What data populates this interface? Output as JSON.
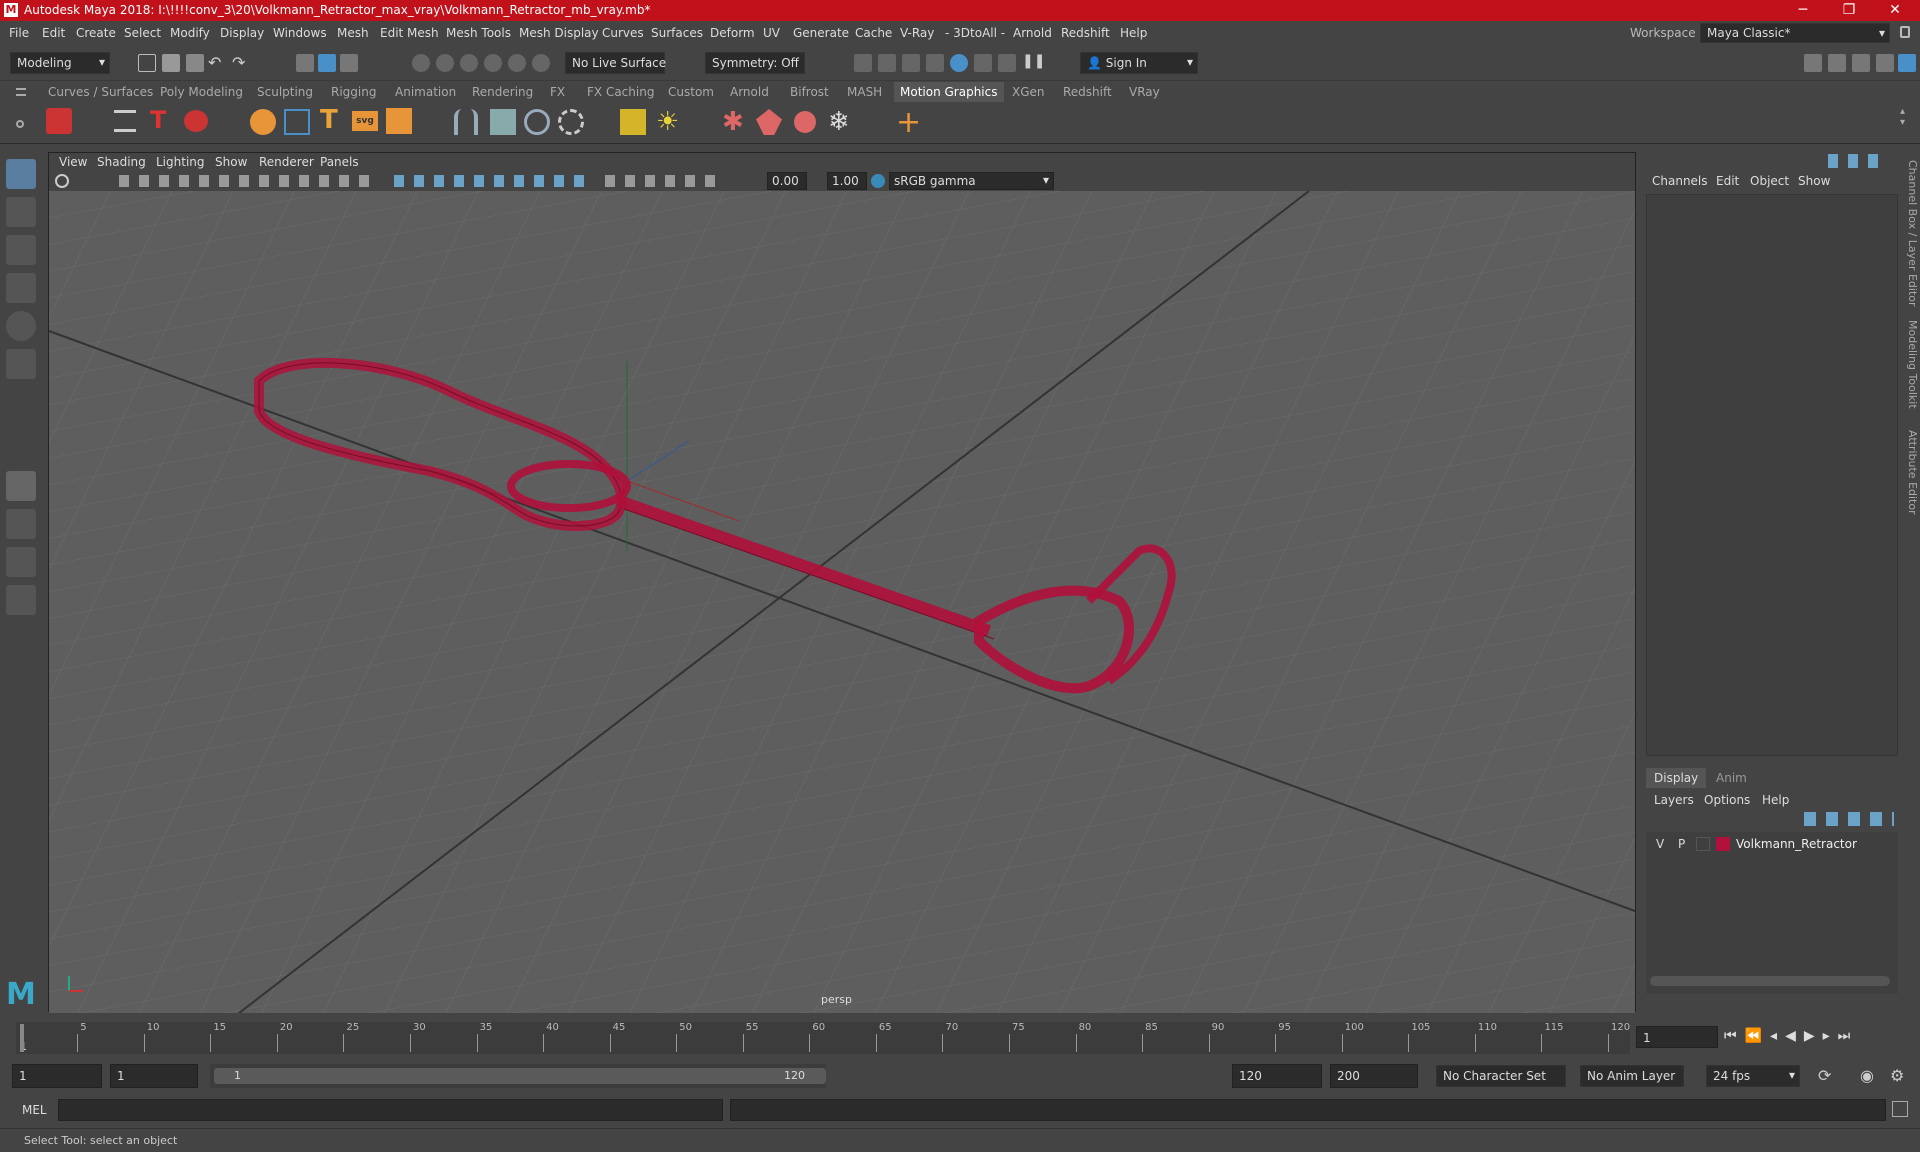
{
  "window": {
    "title": "Autodesk Maya 2018: I:\\!!!!conv_3\\20\\Volkmann_Retractor_max_vray\\Volkmann_Retractor_mb_vray.mb*",
    "logo": "M",
    "min": "─",
    "max": "❐",
    "close": "✕"
  },
  "menus": [
    "File",
    "Edit",
    "Create",
    "Select",
    "Modify",
    "Display",
    "Windows",
    "Mesh",
    "Edit Mesh",
    "Mesh Tools",
    "Mesh Display",
    "Curves",
    "Surfaces",
    "Deform",
    "UV",
    "Generate",
    "Cache",
    "V-Ray",
    "- 3DtoAll -",
    "Arnold",
    "Redshift",
    "Help"
  ],
  "workspace": {
    "label": "Workspace :",
    "value": "Maya Classic*"
  },
  "status": {
    "mode": "Modeling",
    "live_surface": "No Live Surface",
    "symmetry": "Symmetry: Off",
    "sign_in": "Sign In"
  },
  "shelf_tabs": [
    "Curves / Surfaces",
    "Poly Modeling",
    "Sculpting",
    "Rigging",
    "Animation",
    "Rendering",
    "FX",
    "FX Caching",
    "Custom",
    "Arnold",
    "Bifrost",
    "MASH",
    "Motion Graphics",
    "XGen",
    "Redshift",
    "VRay"
  ],
  "shelf_active": "Motion Graphics",
  "viewport": {
    "menus": [
      "View",
      "Shading",
      "Lighting",
      "Show",
      "Renderer",
      "Panels"
    ],
    "exposure": "0.00",
    "gamma": "1.00",
    "color_space": "sRGB gamma",
    "camera": "persp"
  },
  "channel_box": {
    "menus": [
      "Channels",
      "Edit",
      "Object",
      "Show"
    ]
  },
  "side_tabs": [
    "Channel Box / Layer Editor",
    "Modeling Toolkit",
    "Attribute Editor"
  ],
  "layer_editor": {
    "tabs": [
      "Display",
      "Anim"
    ],
    "menus": [
      "Layers",
      "Options",
      "Help"
    ],
    "layer": {
      "v": "V",
      "p": "P",
      "name": "Volkmann_Retractor",
      "color": "#b0103a"
    }
  },
  "timeline": {
    "ticks": [
      "5",
      "10",
      "15",
      "20",
      "25",
      "30",
      "35",
      "40",
      "45",
      "50",
      "55",
      "60",
      "65",
      "70",
      "75",
      "80",
      "85",
      "90",
      "95",
      "100",
      "105",
      "110",
      "115",
      "120"
    ],
    "start_label": "1",
    "current_frame": "1"
  },
  "range": {
    "start": "1",
    "playback_start": "1",
    "slider_start": "1",
    "slider_end": "120",
    "playback_end": "120",
    "end": "200",
    "character_set": "No Character Set",
    "anim_layer": "No Anim Layer",
    "fps": "24 fps"
  },
  "command": {
    "label": "MEL"
  },
  "help_line": "Select Tool: select an object",
  "colors": {
    "title_bar": "#c1121c",
    "wire": "#b0103a"
  }
}
